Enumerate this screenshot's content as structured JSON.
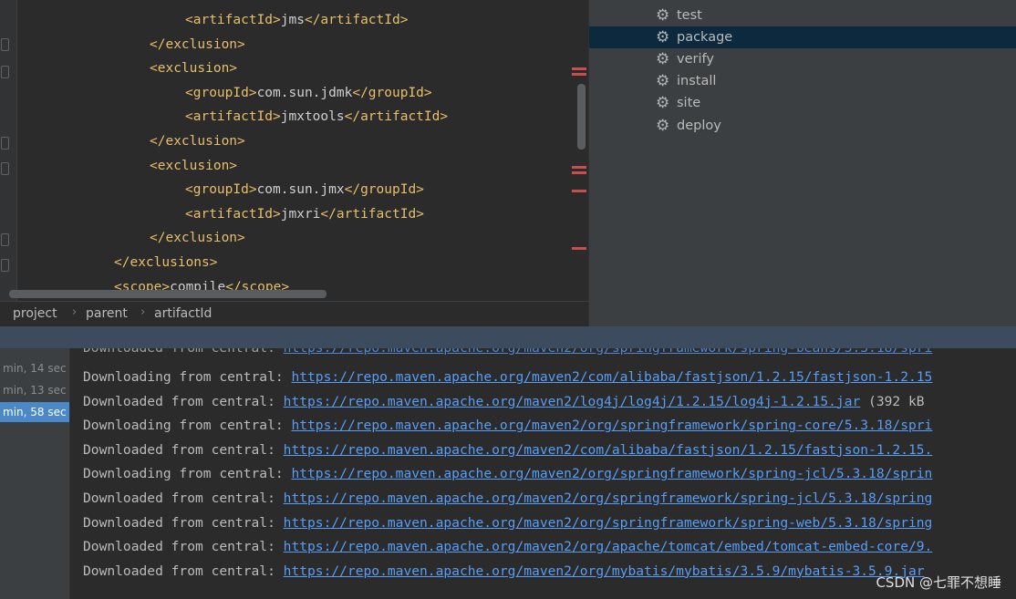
{
  "editor": {
    "lines": [
      {
        "indent": 3,
        "open": "<artifactId>",
        "text": "jms",
        "close": "</artifactId>"
      },
      {
        "indent": 2,
        "open": "</exclusion>",
        "text": "",
        "close": ""
      },
      {
        "indent": 2,
        "open": "<exclusion>",
        "text": "",
        "close": ""
      },
      {
        "indent": 3,
        "open": "<groupId>",
        "text": "com.sun.jdmk",
        "close": "</groupId>"
      },
      {
        "indent": 3,
        "open": "<artifactId>",
        "text": "jmxtools",
        "close": "</artifactId>"
      },
      {
        "indent": 2,
        "open": "</exclusion>",
        "text": "",
        "close": ""
      },
      {
        "indent": 2,
        "open": "<exclusion>",
        "text": "",
        "close": ""
      },
      {
        "indent": 3,
        "open": "<groupId>",
        "text": "com.sun.jmx",
        "close": "</groupId>"
      },
      {
        "indent": 3,
        "open": "<artifactId>",
        "text": "jmxri",
        "close": "</artifactId>"
      },
      {
        "indent": 2,
        "open": "</exclusion>",
        "text": "",
        "close": ""
      },
      {
        "indent": 1,
        "open": "</exclusions>",
        "text": "",
        "close": ""
      },
      {
        "indent": 1,
        "open": "<scope>",
        "text": "compile",
        "close": "</scope>"
      }
    ]
  },
  "breadcrumb": [
    "project",
    "parent",
    "artifactId"
  ],
  "maven": {
    "lifecycle": [
      "test",
      "package",
      "verify",
      "install",
      "site",
      "deploy"
    ],
    "selected": "package"
  },
  "run": {
    "items": [
      "min, 14 sec",
      "min, 13 sec",
      "min, 58 sec"
    ],
    "selected_index": 2
  },
  "console": {
    "lines": [
      {
        "prefix": "Downloading from central: ",
        "url": "https://repo.maven.apache.org/maven2/com/alibaba/fastjson/1.2.15/fastjson-1.2.15",
        "suffix": ""
      },
      {
        "prefix": "Downloaded from central: ",
        "url": "https://repo.maven.apache.org/maven2/log4j/log4j/1.2.15/log4j-1.2.15.jar",
        "suffix": " (392 kB"
      },
      {
        "prefix": "Downloading from central: ",
        "url": "https://repo.maven.apache.org/maven2/org/springframework/spring-core/5.3.18/spri",
        "suffix": ""
      },
      {
        "prefix": "Downloaded from central: ",
        "url": "https://repo.maven.apache.org/maven2/com/alibaba/fastjson/1.2.15/fastjson-1.2.15.",
        "suffix": ""
      },
      {
        "prefix": "Downloading from central: ",
        "url": "https://repo.maven.apache.org/maven2/org/springframework/spring-jcl/5.3.18/sprin",
        "suffix": ""
      },
      {
        "prefix": "Downloaded from central: ",
        "url": "https://repo.maven.apache.org/maven2/org/springframework/spring-jcl/5.3.18/spring",
        "suffix": ""
      },
      {
        "prefix": "Downloaded from central: ",
        "url": "https://repo.maven.apache.org/maven2/org/springframework/spring-web/5.3.18/spring",
        "suffix": ""
      },
      {
        "prefix": "Downloaded from central: ",
        "url": "https://repo.maven.apache.org/maven2/org/apache/tomcat/embed/tomcat-embed-core/9.",
        "suffix": ""
      },
      {
        "prefix": "Downloaded from central: ",
        "url": "https://repo.maven.apache.org/maven2/org/mybatis/mybatis/3.5.9/mybatis-3.5.9.jar",
        "suffix": ""
      }
    ]
  },
  "watermark": "CSDN @七罪不想睡"
}
